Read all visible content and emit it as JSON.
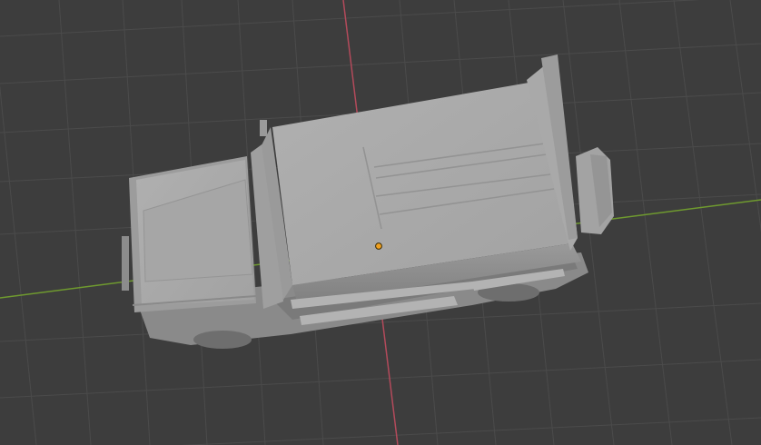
{
  "viewport": {
    "kind": "3d-viewport",
    "view": "perspective",
    "grid": true,
    "colors": {
      "background": "#3d3d3d",
      "grid_line": "#4d4d4d",
      "x_axis": "#b34a5b",
      "y_axis": "#6f9a2f",
      "model": "#a8a8a8",
      "origin_marker": "#f0a020"
    },
    "scene": {
      "object": "vehicle-model",
      "shading": "solid",
      "selected": true
    }
  }
}
